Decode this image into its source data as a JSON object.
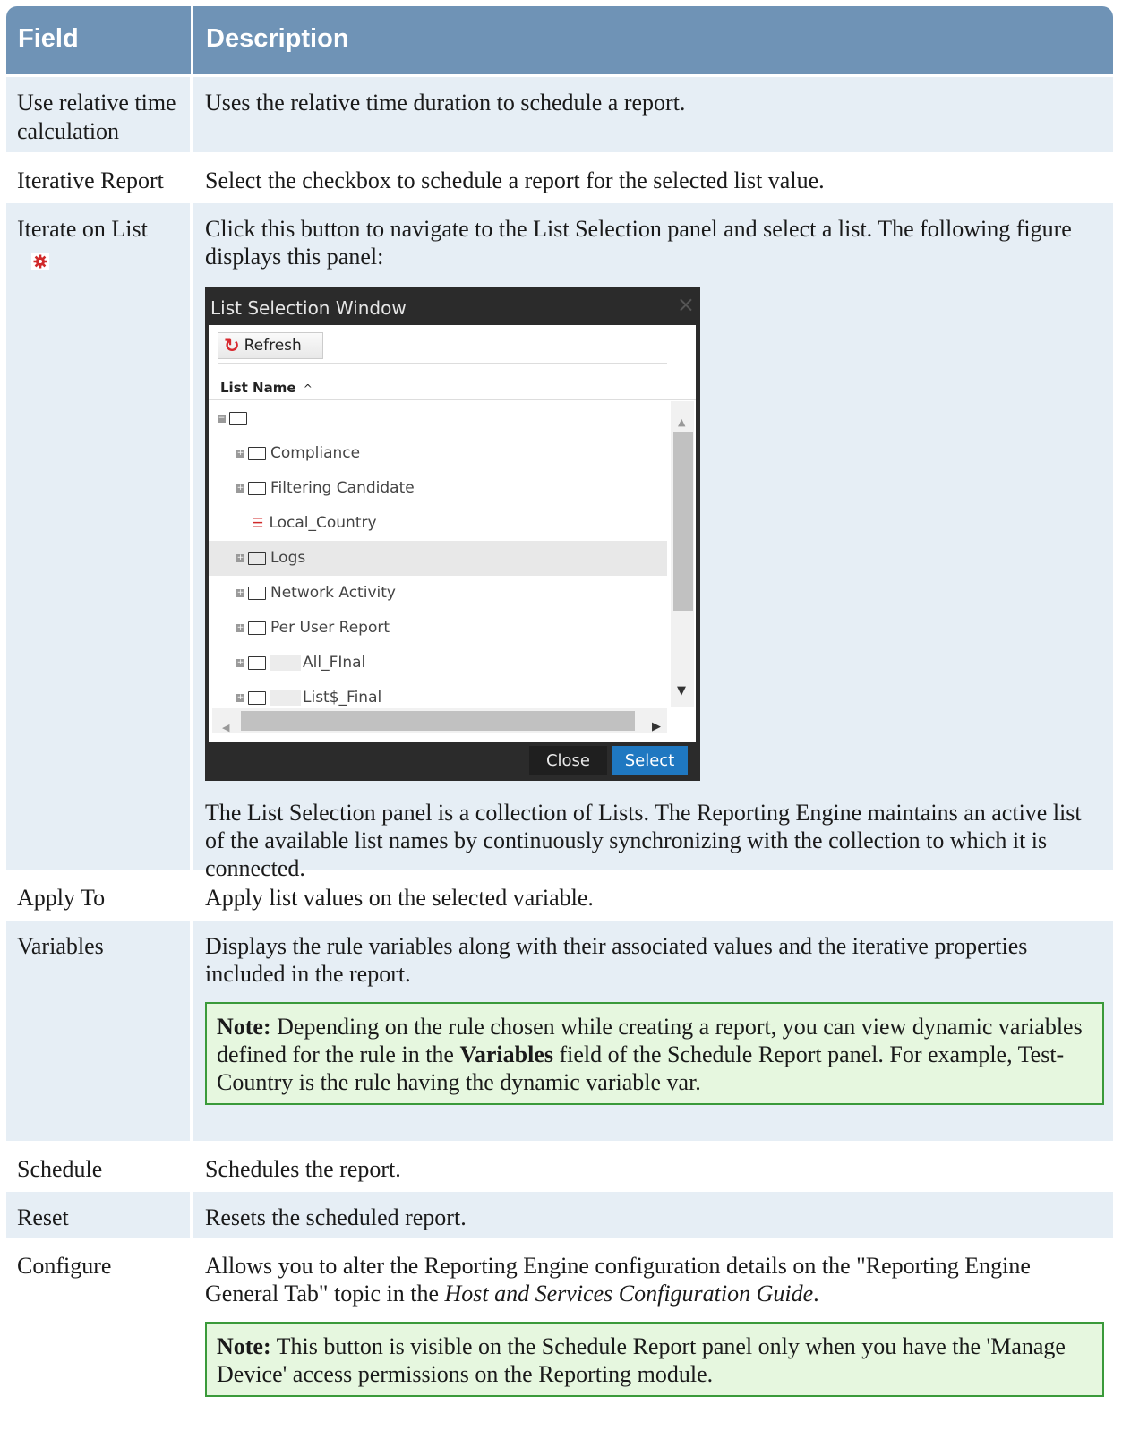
{
  "header": {
    "field": "Field",
    "description": "Description"
  },
  "rows": {
    "r0": {
      "field": "Use relative time calculation",
      "desc": "Uses the relative time duration to schedule a report."
    },
    "r1": {
      "field": "Iterative Report",
      "desc": "Select the checkbox to schedule a report for the selected list value."
    },
    "r2": {
      "field": "Iterate on List",
      "desc": "Click this button to navigate to the List Selection panel and select a list. The following figure displays this panel:",
      "desc_after": "The List Selection panel is a collection of Lists. The Reporting Engine maintains an active list of the available list names by continuously synchronizing with the collection to which it is connected."
    },
    "r3": {
      "field": "Apply To",
      "desc": "Apply list values on the selected variable."
    },
    "r4": {
      "field": "Variables",
      "desc": "Displays the rule variables along with their associated values and the iterative properties included in the report.",
      "note_label": "Note:",
      "note_a": " Depending on the rule chosen while creating a report, you can view dynamic variables defined for the rule in the ",
      "note_b": "Variables",
      "note_c": " field of the Schedule Report panel. For example, Test-Country is the rule having the dynamic variable var."
    },
    "r5": {
      "field": "Schedule",
      "desc": "Schedules the report."
    },
    "r6": {
      "field": "Reset",
      "desc": "Resets the scheduled report."
    },
    "r7": {
      "field": "Configure",
      "desc_a": "Allows you to alter the Reporting Engine configuration details on the \"Reporting Engine General Tab\" topic in the ",
      "desc_b": "Host and Services Configuration Guide",
      "desc_c": ".",
      "note_label": "Note:",
      "note_a": " This button is visible on the Schedule Report panel only when you have the 'Manage Device' access permissions on the Reporting module."
    }
  },
  "window": {
    "title": "List Selection Window",
    "close_x": "×",
    "refresh": "Refresh",
    "column": "List Name",
    "sort": "^",
    "items": {
      "i1": "Compliance",
      "i2": "Filtering Candidate",
      "i3": "Local_Country",
      "i4": "Logs",
      "i5": "Network Activity",
      "i6": "Per User Report",
      "i7": "All_FInal",
      "i8": "List$_Final"
    },
    "btn_close": "Close",
    "btn_select": "Select"
  },
  "colors": {
    "header_bg": "#6f93b6",
    "row_shade": "#e6eef5",
    "note_border": "#3a9a3a",
    "note_bg": "#e6f7df",
    "select_btn": "#1f78c1"
  },
  "icons": {
    "iterate_button": "gear-icon",
    "refresh": "refresh-icon",
    "list": "list-icon",
    "folder": "folder-icon"
  }
}
